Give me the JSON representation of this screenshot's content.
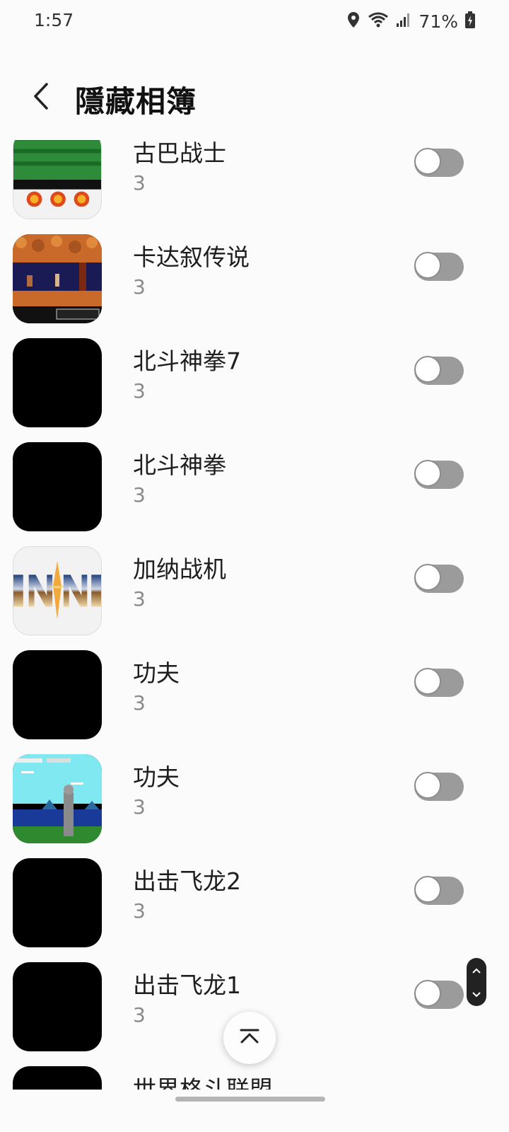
{
  "status_bar": {
    "time": "1:57",
    "battery": "71%",
    "icons": [
      "location-icon",
      "wifi-icon",
      "signal-icon",
      "battery-charging-icon"
    ]
  },
  "header": {
    "title": "隱藏相簿",
    "back_icon": "chevron-left-icon"
  },
  "albums": [
    {
      "name": "古巴战士",
      "count": "3",
      "thumb": "green-game-art",
      "enabled": false
    },
    {
      "name": "卡达叙传说",
      "count": "3",
      "thumb": "orange-cave-scene",
      "enabled": false
    },
    {
      "name": "北斗神拳7",
      "count": "3",
      "thumb": "black",
      "enabled": false
    },
    {
      "name": "北斗神拳",
      "count": "3",
      "thumb": "black",
      "enabled": false
    },
    {
      "name": "加纳战机",
      "count": "3",
      "thumb": "chrome-logo",
      "enabled": false
    },
    {
      "name": "功夫",
      "count": "3",
      "thumb": "black",
      "enabled": false
    },
    {
      "name": "功夫",
      "count": "3",
      "thumb": "cyan-sky-scene",
      "enabled": false
    },
    {
      "name": "出击飞龙2",
      "count": "3",
      "thumb": "black",
      "enabled": false
    },
    {
      "name": "出击飞龙1",
      "count": "3",
      "thumb": "black",
      "enabled": false
    },
    {
      "name": "世界格斗联盟",
      "count": "",
      "thumb": "black",
      "enabled": false
    }
  ],
  "controls": {
    "scroll_top_icon": "scroll-to-top-icon",
    "scroll_up_icon": "chevron-up-icon",
    "scroll_down_icon": "chevron-down-icon"
  },
  "colors": {
    "background": "#fbfbfb",
    "toggle_off": "#9b9b9b",
    "secondary_text": "#8a8a8a"
  }
}
